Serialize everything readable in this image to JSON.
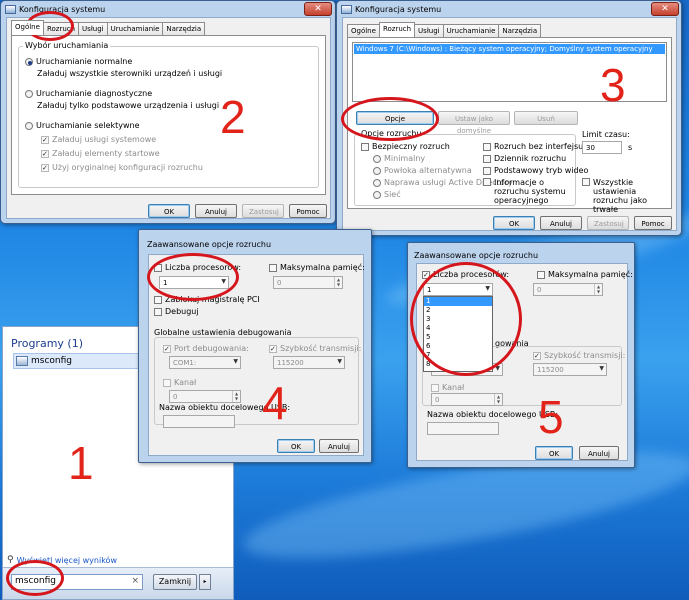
{
  "start_menu": {
    "programs_header": "Programy (1)",
    "program_item": "msconfig",
    "see_more": "Wyświetl więcej wyników",
    "search_value": "msconfig",
    "clear_glyph": "×",
    "shutdown_label": "Zamknij",
    "shutdown_arrow": "▸"
  },
  "win1": {
    "title": "Konfiguracja systemu",
    "close": "✕",
    "tabs": [
      "Ogólne",
      "Rozruch",
      "Usługi",
      "Uruchamianie",
      "Narzędzia"
    ],
    "group_label": "Wybór uruchamiania",
    "normal_label": "Uruchamianie normalne",
    "normal_desc": "Załaduj wszystkie sterowniki urządzeń i usługi",
    "diag_label": "Uruchamianie diagnostyczne",
    "diag_desc": "Załaduj tylko podstawowe urządzenia i usługi",
    "selective_label": "Uruchamianie selektywne",
    "opt_services": "Załaduj usługi systemowe",
    "opt_startup": "Załaduj elementy startowe",
    "opt_original": "Użyj oryginalnej konfiguracji rozruchu",
    "ok": "OK",
    "cancel": "Anuluj",
    "apply": "Zastosuj",
    "help": "Pomoc"
  },
  "win3": {
    "title": "Konfiguracja systemu",
    "close": "✕",
    "tabs": [
      "Ogólne",
      "Rozruch",
      "Usługi",
      "Uruchamianie",
      "Narzędzia"
    ],
    "os_entry": "Windows 7 (C:\\Windows) : Bieżący system operacyjny; Domyślny system operacyjny",
    "advanced_button": "Opcje zaawansowane...",
    "default_button": "Ustaw jako domyślne",
    "delete_button": "Usuń",
    "boot_options_label": "Opcje rozruchu",
    "safe_boot": "Bezpieczny rozruch",
    "minimal": "Minimalny",
    "alt_shell": "Powłoka alternatywna",
    "ad_repair": "Naprawa usługi Active Directory",
    "network": "Sieć",
    "no_gui": "Rozruch bez interfejsu GUI",
    "boot_log": "Dziennik rozruchu",
    "base_video": "Podstawowy tryb wideo",
    "os_info": "Informacje o rozruchu systemu operacyjnego",
    "timeout_label": "Limit czasu:",
    "timeout_value": "30",
    "timeout_unit": "s",
    "persistent": "Wszystkie ustawienia rozruchu jako trwałe",
    "ok": "OK",
    "cancel": "Anuluj",
    "apply": "Zastosuj",
    "help": "Pomoc"
  },
  "win4": {
    "title": "Zaawansowane opcje rozruchu",
    "num_proc": "Liczba procesorów:",
    "num_proc_value": "1",
    "max_mem": "Maksymalna pamięć:",
    "max_mem_value": "0",
    "pci_lock": "Zablokuj magistralę PCI",
    "debug": "Debuguj",
    "debug_settings": "Globalne ustawienia debugowania",
    "debug_port": "Port debugowania:",
    "debug_port_value": "COM1:",
    "baud_rate": "Szybkość transmisji:",
    "baud_rate_value": "115200",
    "channel": "Kanał",
    "channel_value": "0",
    "usb_target": "Nazwa obiektu docelowego USB:",
    "ok": "OK",
    "cancel": "Anuluj"
  },
  "win5": {
    "title": "Zaawansowane opcje rozruchu",
    "num_proc": "Liczba procesorów:",
    "num_proc_value": "1",
    "dropdown_options": [
      "1",
      "2",
      "3",
      "4",
      "5",
      "6",
      "7",
      "8"
    ],
    "max_mem": "Maksymalna pamięć:",
    "max_mem_value": "0",
    "debug_settings_partial": "gowania",
    "debug_port_value": "COM1:",
    "baud_rate": "Szybkość transmisji:",
    "baud_rate_value": "115200",
    "channel": "Kanał",
    "channel_value": "0",
    "usb_target": "Nazwa obiektu docelowego USB:",
    "ok": "OK",
    "cancel": "Anuluj"
  },
  "annotations": {
    "numbers": [
      "1",
      "2",
      "3",
      "4",
      "5"
    ],
    "ring_color": "#d6161d",
    "number_color": "#e2231a"
  }
}
